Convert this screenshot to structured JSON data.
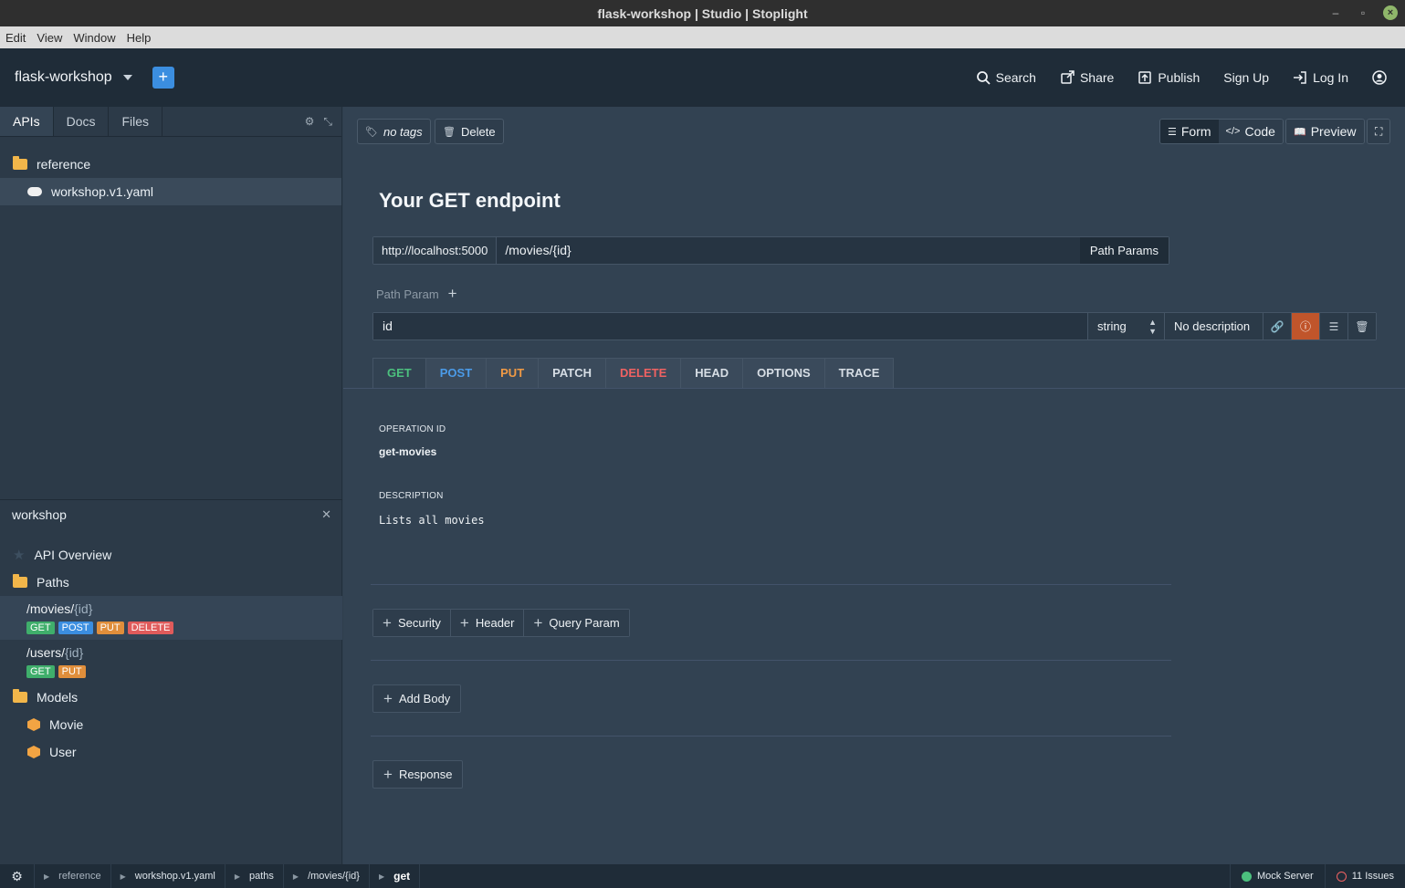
{
  "window": {
    "title": "flask-workshop | Studio | Stoplight"
  },
  "menu": [
    "Edit",
    "View",
    "Window",
    "Help"
  ],
  "header": {
    "project": "flask-workshop",
    "add_button": "+",
    "search": "Search",
    "share": "Share",
    "publish": "Publish",
    "signup": "Sign Up",
    "login": "Log In"
  },
  "sidebar": {
    "tabs": [
      "APIs",
      "Docs",
      "Files"
    ],
    "folder": "reference",
    "file": "workshop.v1.yaml",
    "panel_title": "workshop",
    "overview": "API Overview",
    "paths_label": "Paths",
    "paths": [
      {
        "base": "/movies/",
        "param": "{id}",
        "methods": [
          "GET",
          "POST",
          "PUT",
          "DELETE"
        ]
      },
      {
        "base": "/users/",
        "param": "{id}",
        "methods": [
          "GET",
          "PUT"
        ]
      }
    ],
    "models_label": "Models",
    "models": [
      "Movie",
      "User"
    ]
  },
  "toolbar": {
    "tags": "no tags",
    "delete": "Delete",
    "form": "Form",
    "code": "Code",
    "preview": "Preview"
  },
  "endpoint": {
    "title": "Your GET endpoint",
    "host": "http://localhost:5000",
    "path": "/movies/{id}",
    "path_params_btn": "Path Params",
    "path_param_label": "Path Param",
    "param_name": "id",
    "param_type": "string",
    "param_desc": "No description"
  },
  "methods": [
    "GET",
    "POST",
    "PUT",
    "PATCH",
    "DELETE",
    "HEAD",
    "OPTIONS",
    "TRACE"
  ],
  "operation": {
    "op_id_label": "OPERATION ID",
    "op_id": "get-movies",
    "desc_label": "DESCRIPTION",
    "desc": "Lists all movies"
  },
  "actions": {
    "security": "Security",
    "header": "Header",
    "query": "Query Param",
    "body": "Add Body",
    "response": "Response"
  },
  "status": {
    "crumbs": [
      "reference",
      "workshop.v1.yaml",
      "paths",
      "/movies/{id}",
      "get"
    ],
    "mock": "Mock Server",
    "issues": "11 Issues"
  }
}
